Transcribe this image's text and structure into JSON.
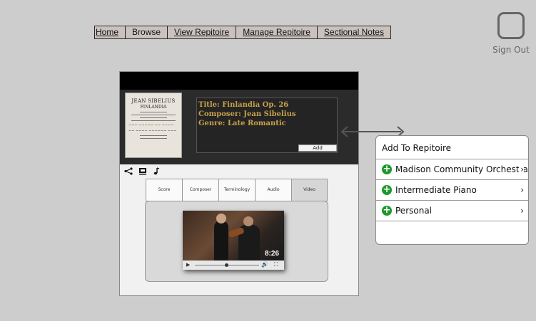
{
  "nav": {
    "items": [
      "Home",
      "Browse",
      "View Repitoire",
      "Manage Repitoire",
      "Sectional Notes"
    ]
  },
  "signout": {
    "label": "Sign Out"
  },
  "piece": {
    "cover": {
      "line1": "JEAN SIBELIUS",
      "line2": "FINLANDIA"
    },
    "title": "Title: Finlandia Op. 26",
    "composer": "Composer: Jean Sibelius",
    "genre": "Genre: Late Romantic",
    "add_label": "Add"
  },
  "tabs": [
    "Score",
    "Composer",
    "Terminology",
    "Audio",
    "Video"
  ],
  "video": {
    "duration": "8:26"
  },
  "add_panel": {
    "title": "Add To Repitoire",
    "items": [
      "Madison Community Orchestra",
      "Intermediate Piano",
      "Personal"
    ]
  },
  "colors": {
    "background": "#cdcdcd",
    "header_dark": "#2b2b2b",
    "gold_text": "#c9a04a",
    "add_green": "#1a9a2a"
  },
  "icons": [
    "share-icon",
    "playlist-icon",
    "music-note-icon",
    "plus-circle-icon",
    "chevron-right-icon",
    "double-arrow-icon"
  ]
}
